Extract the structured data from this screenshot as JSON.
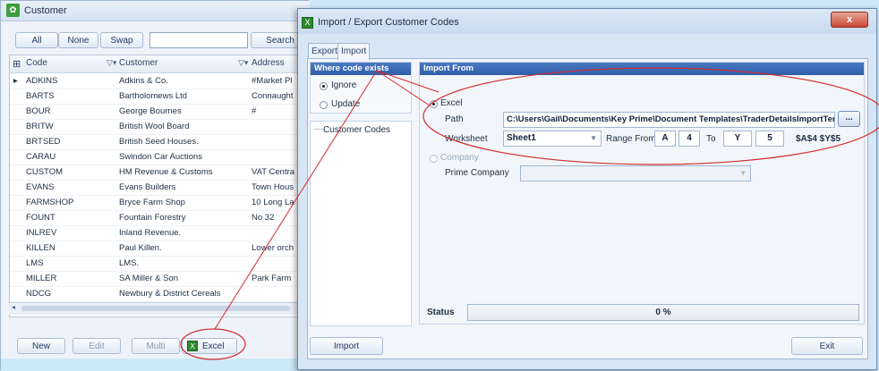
{
  "customer_window": {
    "title": "Customer",
    "toolbar": {
      "all": "All",
      "none": "None",
      "swap": "Swap",
      "search": "Search",
      "filter_value": ""
    },
    "columns": [
      "Code",
      "Customer",
      "Address"
    ],
    "rows": [
      {
        "code": "ADKINS",
        "customer": "Adkins & Co.",
        "address": "#Market Pl"
      },
      {
        "code": "BARTS",
        "customer": "Bartholomews Ltd",
        "address": "Connaught"
      },
      {
        "code": "BOUR",
        "customer": "George Bournes",
        "address": "#"
      },
      {
        "code": "BRITW",
        "customer": "British Wool Board",
        "address": ""
      },
      {
        "code": "BRTSED",
        "customer": "British Seed Houses.",
        "address": ""
      },
      {
        "code": "CARAU",
        "customer": "Swindon Car Auctions",
        "address": ""
      },
      {
        "code": "CUSTOM",
        "customer": "HM Revenue & Customs",
        "address": "VAT Centra"
      },
      {
        "code": "EVANS",
        "customer": "Evans Builders",
        "address": "Town Hous"
      },
      {
        "code": "FARMSHOP",
        "customer": "Bryce Farm Shop",
        "address": "10 Long La"
      },
      {
        "code": "FOUNT",
        "customer": "Fountain Forestry",
        "address": "No 32"
      },
      {
        "code": "INLREV",
        "customer": "Inland Revenue.",
        "address": ""
      },
      {
        "code": "KILLEN",
        "customer": "Paul Killen.",
        "address": "Lower orch"
      },
      {
        "code": "LMS",
        "customer": "LMS.",
        "address": ""
      },
      {
        "code": "MILLER",
        "customer": "SA Miller & Son",
        "address": "Park Farm"
      },
      {
        "code": "NDCG",
        "customer": "Newbury & District Cereals",
        "address": ""
      }
    ],
    "footer": {
      "new": "New",
      "edit": "Edit",
      "multi": "Multi",
      "excel": "Excel"
    }
  },
  "dialog": {
    "title": "Import / Export Customer Codes",
    "close": "x",
    "tabs": [
      "Export",
      "Import"
    ],
    "where_code_exists": {
      "header": "Where code exists",
      "ignore": "Ignore",
      "update": "Update",
      "tree_item": "Customer Codes"
    },
    "import_from": {
      "header": "Import From",
      "excel_label": "Excel",
      "path_label": "Path",
      "path_value": "C:\\Users\\Gail\\Documents\\Key Prime\\Document Templates\\TraderDetailsImportTempl",
      "browse": "...",
      "worksheet_label": "Worksheet",
      "worksheet_value": "Sheet1",
      "range_from_label": "Range From",
      "from_col": "A",
      "from_row": "4",
      "to_label": "To",
      "to_col": "Y",
      "to_row": "5",
      "range_text": "$A$4 $Y$5",
      "company_label": "Company",
      "prime_company_label": "Prime Company",
      "prime_company_value": ""
    },
    "status": {
      "label": "Status",
      "progress_text": "0 %",
      "progress": 0
    },
    "buttons": {
      "import": "Import",
      "exit": "Exit"
    }
  },
  "colors": {
    "panel_header": "#2f5ea8",
    "annotation": "#d42a2a",
    "close": "#c94a35"
  }
}
